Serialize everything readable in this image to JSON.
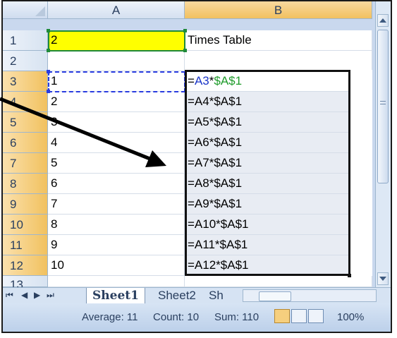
{
  "columns": [
    "A",
    "B"
  ],
  "rows": [
    {
      "num": "1",
      "a": "2",
      "b": "Times Table"
    },
    {
      "num": "2",
      "a": "",
      "b": ""
    },
    {
      "num": "3",
      "a": "1",
      "b_parts": [
        "=",
        "A3",
        "*",
        "$A$1"
      ]
    },
    {
      "num": "4",
      "a": "2",
      "b": "=A4*$A$1"
    },
    {
      "num": "5",
      "a": "3",
      "b": "=A5*$A$1"
    },
    {
      "num": "6",
      "a": "4",
      "b": "=A6*$A$1"
    },
    {
      "num": "7",
      "a": "5",
      "b": "=A7*$A$1"
    },
    {
      "num": "8",
      "a": "6",
      "b": "=A8*$A$1"
    },
    {
      "num": "9",
      "a": "7",
      "b": "=A9*$A$1"
    },
    {
      "num": "10",
      "a": "8",
      "b": "=A10*$A$1"
    },
    {
      "num": "11",
      "a": "9",
      "b": "=A11*$A$1"
    },
    {
      "num": "12",
      "a": "10",
      "b": "=A12*$A$1"
    },
    {
      "num": "13",
      "a": "",
      "b": ""
    }
  ],
  "tabs": {
    "nav": [
      "⏮",
      "◀",
      "▶",
      "⏭"
    ],
    "sheet1": "Sheet1",
    "sheet2": "Sheet2",
    "sheet3": "Sh"
  },
  "status": {
    "average": "Average: 11",
    "count": "Count: 10",
    "sum": "Sum: 110",
    "zoom": "100%"
  },
  "colors": {
    "highlight_cell": "#ffff00",
    "relative_ref": "#1a35c8",
    "absolute_ref": "#1e9b2a",
    "selected_header": "#f1c15f"
  }
}
